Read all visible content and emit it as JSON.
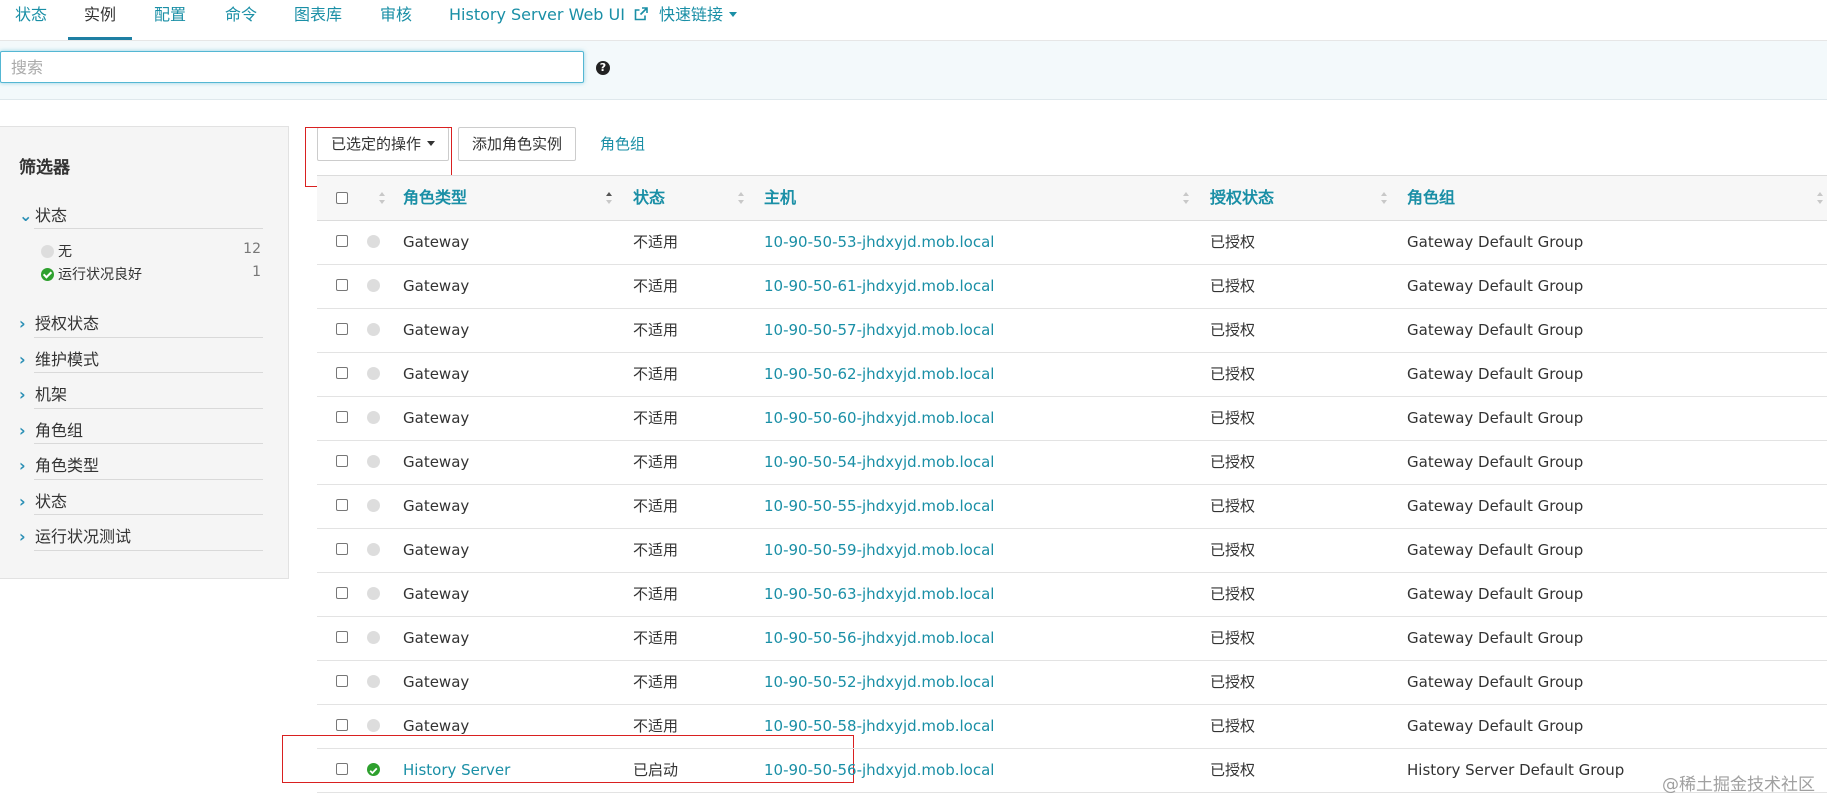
{
  "nav": {
    "tabs": [
      {
        "label": "状态"
      },
      {
        "label": "实例"
      },
      {
        "label": "配置"
      },
      {
        "label": "命令"
      },
      {
        "label": "图表库"
      },
      {
        "label": "审核"
      },
      {
        "label": "History Server Web UI"
      },
      {
        "label": "快速链接"
      }
    ],
    "active_tab": "实例"
  },
  "search": {
    "placeholder": "搜索",
    "value": ""
  },
  "sidebar": {
    "title": "筛选器",
    "facets": [
      {
        "label": "状态",
        "expanded": true,
        "items": [
          {
            "label": "无",
            "count": "12",
            "icon": "grey-status-dot"
          },
          {
            "label": "运行状况良好",
            "count": "1",
            "icon": "green-check-icon"
          }
        ]
      },
      {
        "label": "授权状态",
        "expanded": false
      },
      {
        "label": "维护模式",
        "expanded": false
      },
      {
        "label": "机架",
        "expanded": false
      },
      {
        "label": "角色组",
        "expanded": false
      },
      {
        "label": "角色类型",
        "expanded": false
      },
      {
        "label": "状态",
        "expanded": false
      },
      {
        "label": "运行状况测试",
        "expanded": false
      }
    ]
  },
  "toolbar": {
    "actions_label": "已选定的操作",
    "add_label": "添加角色实例",
    "rolegroup_label": "角色组"
  },
  "table": {
    "columns": [
      "角色类型",
      "状态",
      "主机",
      "授权状态",
      "角色组"
    ],
    "rows": [
      {
        "role": "Gateway",
        "status": "不适用",
        "host": "10-90-50-53-jhdxyjd.mob.local",
        "auth": "已授权",
        "group": "Gateway Default Group",
        "health": "none"
      },
      {
        "role": "Gateway",
        "status": "不适用",
        "host": "10-90-50-61-jhdxyjd.mob.local",
        "auth": "已授权",
        "group": "Gateway Default Group",
        "health": "none"
      },
      {
        "role": "Gateway",
        "status": "不适用",
        "host": "10-90-50-57-jhdxyjd.mob.local",
        "auth": "已授权",
        "group": "Gateway Default Group",
        "health": "none"
      },
      {
        "role": "Gateway",
        "status": "不适用",
        "host": "10-90-50-62-jhdxyjd.mob.local",
        "auth": "已授权",
        "group": "Gateway Default Group",
        "health": "none"
      },
      {
        "role": "Gateway",
        "status": "不适用",
        "host": "10-90-50-60-jhdxyjd.mob.local",
        "auth": "已授权",
        "group": "Gateway Default Group",
        "health": "none"
      },
      {
        "role": "Gateway",
        "status": "不适用",
        "host": "10-90-50-54-jhdxyjd.mob.local",
        "auth": "已授权",
        "group": "Gateway Default Group",
        "health": "none"
      },
      {
        "role": "Gateway",
        "status": "不适用",
        "host": "10-90-50-55-jhdxyjd.mob.local",
        "auth": "已授权",
        "group": "Gateway Default Group",
        "health": "none"
      },
      {
        "role": "Gateway",
        "status": "不适用",
        "host": "10-90-50-59-jhdxyjd.mob.local",
        "auth": "已授权",
        "group": "Gateway Default Group",
        "health": "none"
      },
      {
        "role": "Gateway",
        "status": "不适用",
        "host": "10-90-50-63-jhdxyjd.mob.local",
        "auth": "已授权",
        "group": "Gateway Default Group",
        "health": "none"
      },
      {
        "role": "Gateway",
        "status": "不适用",
        "host": "10-90-50-56-jhdxyjd.mob.local",
        "auth": "已授权",
        "group": "Gateway Default Group",
        "health": "none"
      },
      {
        "role": "Gateway",
        "status": "不适用",
        "host": "10-90-50-52-jhdxyjd.mob.local",
        "auth": "已授权",
        "group": "Gateway Default Group",
        "health": "none"
      },
      {
        "role": "Gateway",
        "status": "不适用",
        "host": "10-90-50-58-jhdxyjd.mob.local",
        "auth": "已授权",
        "group": "Gateway Default Group",
        "health": "none"
      },
      {
        "role": "History Server",
        "status": "已启动",
        "host": "10-90-50-56-jhdxyjd.mob.local",
        "auth": "已授权",
        "group": "History Server Default Group",
        "health": "good"
      }
    ]
  },
  "watermark": "@稀土掘金技术社区",
  "colors": {
    "accent": "#1a8fa6",
    "highlight": "#d92020",
    "good": "#2ea02e",
    "none": "#dddddd"
  }
}
